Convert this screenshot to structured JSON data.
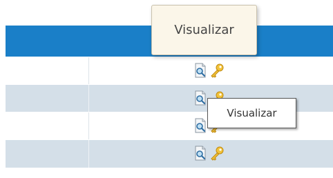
{
  "table": {
    "rows": [
      {
        "action_view": "view-icon",
        "action_key": "key-icon"
      },
      {
        "action_view": "view-icon",
        "action_key": "key-icon"
      },
      {
        "action_view": "view-icon",
        "action_key": "key-icon"
      },
      {
        "action_view": "view-icon",
        "action_key": "key-icon"
      }
    ]
  },
  "tooltips": {
    "large": "Visualizar",
    "small": "Visualizar"
  },
  "colors": {
    "header": "#1a7fc8",
    "row_alt": "#d4dfe8",
    "row": "#ffffff",
    "tooltip_large_bg": "#fbf6e9"
  }
}
